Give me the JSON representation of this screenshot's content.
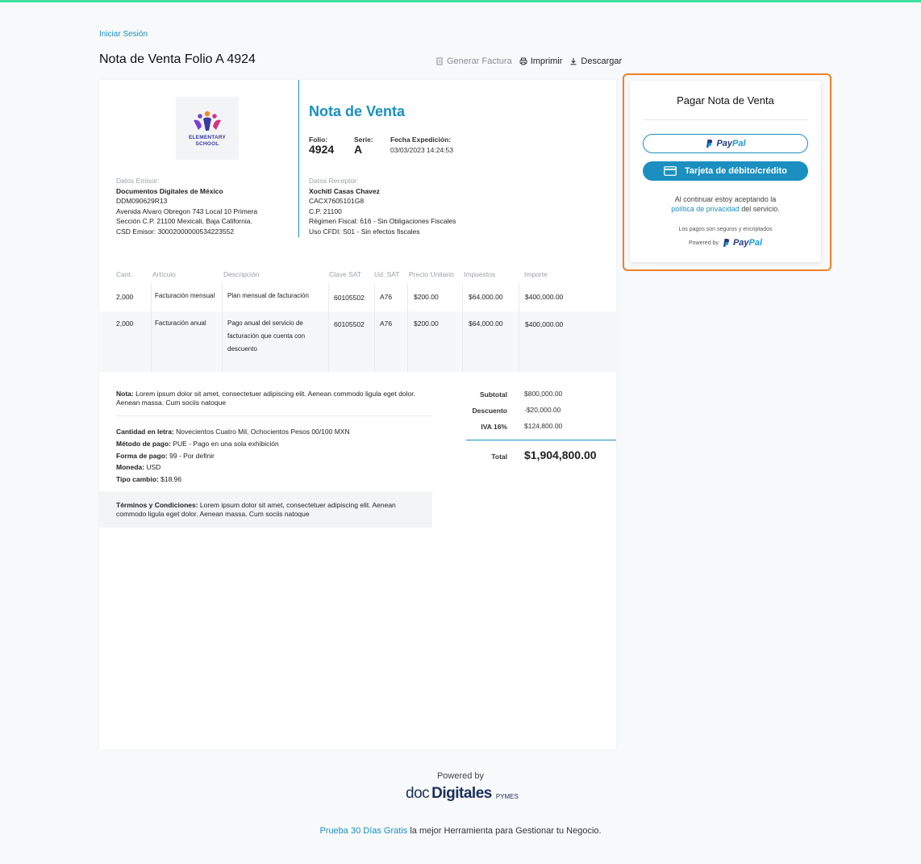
{
  "header": {
    "login": "Iniciar Sesión",
    "title": "Nota de Venta Folio A 4924",
    "actions": {
      "generar": "Generar Factura",
      "imprimir": "Imprimir",
      "descargar": "Descargar"
    }
  },
  "invoice": {
    "logo_text_1": "ELEMENTARY",
    "logo_text_2": "SCHOOL",
    "title": "Nota de Venta",
    "folio_label": "Folio:",
    "folio": "4924",
    "serie_label": "Serie:",
    "serie": "A",
    "fecha_label": "Fecha Expedición:",
    "fecha": "03/03/2023 14:24:53",
    "emisor": {
      "label": "Datos Emisor:",
      "name": "Documentos Digitales de México",
      "rfc": "DDM090629R13",
      "addr1": "Avenida Alvaro Obregon 743 Local 10 Primera",
      "addr2": "Sección C.P. 21100 Mexicali, Baja California.",
      "csd": "CSD Emisor: 30002000000534223552"
    },
    "receptor": {
      "label": "Datos Receptor:",
      "name": "Xochitl Casas Chavez",
      "rfc": "CACX7605101G8",
      "cp": "C.P. 21100",
      "regimen": "Régimen Fiscal: 616 - Sin Obligaciones Fiscales",
      "uso": "Uso CFDI: S01 - Sin efectos fiscales"
    },
    "columns": [
      "Cant.",
      "Artículo",
      "Descripción",
      "Clave SAT",
      "Ud. SAT",
      "Precio Unitario",
      "Impuestos",
      "Importe"
    ],
    "rows": [
      {
        "cant": "2,000",
        "articulo": "Facturación mensual",
        "descripcion": "Plan mensual de facturación",
        "clave": "60105502",
        "ud": "A76",
        "precio": "$200.00",
        "impuestos": "$64,000.00",
        "importe": "$400,000.00"
      },
      {
        "cant": "2,000",
        "articulo": "Facturación anual",
        "descripcion": "Pago anual del servicio de facturación que cuenta con descuento",
        "clave": "60105502",
        "ud": "A76",
        "precio": "$200.00",
        "impuestos": "$64,000.00",
        "importe": "$400,000.00"
      }
    ],
    "nota_label": "Nota:",
    "nota": "Lorem ipsum dolor sit amet, consectetuer adipiscing elit. Aenean commodo ligula eget dolor. Aenean massa. Cum sociis natoque",
    "cantidad_label": "Cantidad en letra:",
    "cantidad": "Novecientos Cuatro Mil, Ochocientos Pesos 00/100 MXN",
    "metodo_label": "Método de pago:",
    "metodo": "PUE - Pago en una sola exhibición",
    "forma_label": "Forma de pago:",
    "forma": "99 - Por definir",
    "moneda_label": "Moneda:",
    "moneda": "USD",
    "tipo_label": "Tipo cambio:",
    "tipo": "$18.96",
    "terminos_label": "Términos y Condiciones:",
    "terminos": "Lorem ipsum dolor sit amet, consectetuer adipiscing elit. Aenean commodo ligula eget dolor. Aenean massa. Cum sociis natoque",
    "totals": {
      "subtotal_label": "Subtotal",
      "subtotal": "$800,000.00",
      "descuento_label": "Descuento",
      "descuento": "-$20,000.00",
      "iva_label": "IVA 16%",
      "iva": "$124,800.00",
      "total_label": "Total",
      "total": "$1,904,800.00"
    }
  },
  "payment": {
    "title": "Pagar Nota de Venta",
    "paypal_pay": "Pay",
    "paypal_pal": "Pal",
    "card_button": "Tarjeta de débito/crédito",
    "terms_1": "Al continuar estoy aceptando la",
    "terms_link": "política de privacidad",
    "terms_2": " del servicio.",
    "secure": "Los pagos son seguros y encriptados",
    "powered_by": "Powered by"
  },
  "footer": {
    "powered": "Powered by",
    "logo_doc": "doc",
    "logo_digitales": "Digitales",
    "logo_pymes": "PYMES",
    "cta_link": "Prueba 30 Días Gratis",
    "cta_text": " la mejor Herramienta para Gestionar tu Negocio."
  },
  "colors": {
    "accent": "#1a8fc0",
    "highlight": "#f07f2a",
    "topbar": "#3ee0a1"
  }
}
